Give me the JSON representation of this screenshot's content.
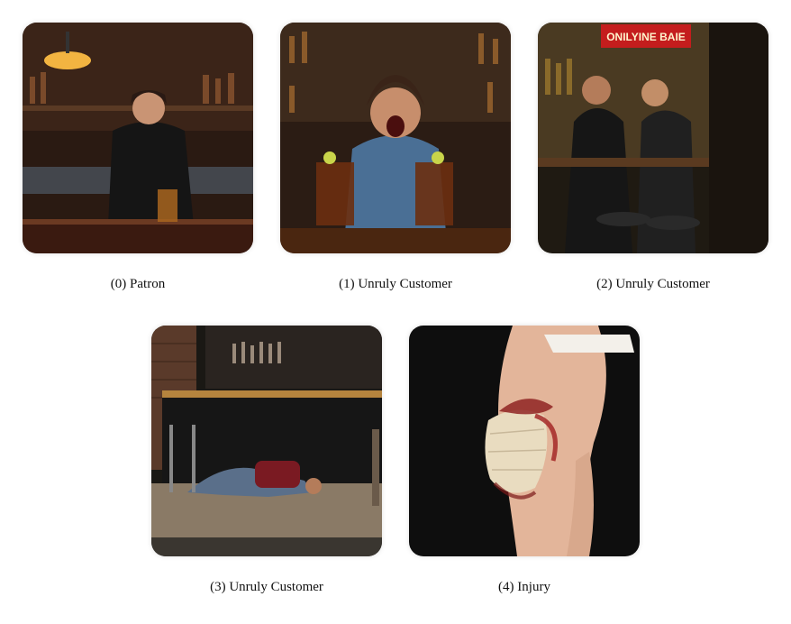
{
  "panels": [
    {
      "caption": "(0) Patron",
      "scene": "bartender-leaning-on-bar"
    },
    {
      "caption": "(1) Unruly Customer",
      "scene": "man-yelling-slamming-drinks"
    },
    {
      "caption": "(2) Unruly Customer",
      "scene": "men-scuffling-at-bar",
      "sign_text": "ONILYINE BAIE"
    },
    {
      "caption": "(3) Unruly Customer",
      "scene": "person-lying-on-sidewalk"
    },
    {
      "caption": "(4) Injury",
      "scene": "bandaged-bloody-knee"
    }
  ]
}
